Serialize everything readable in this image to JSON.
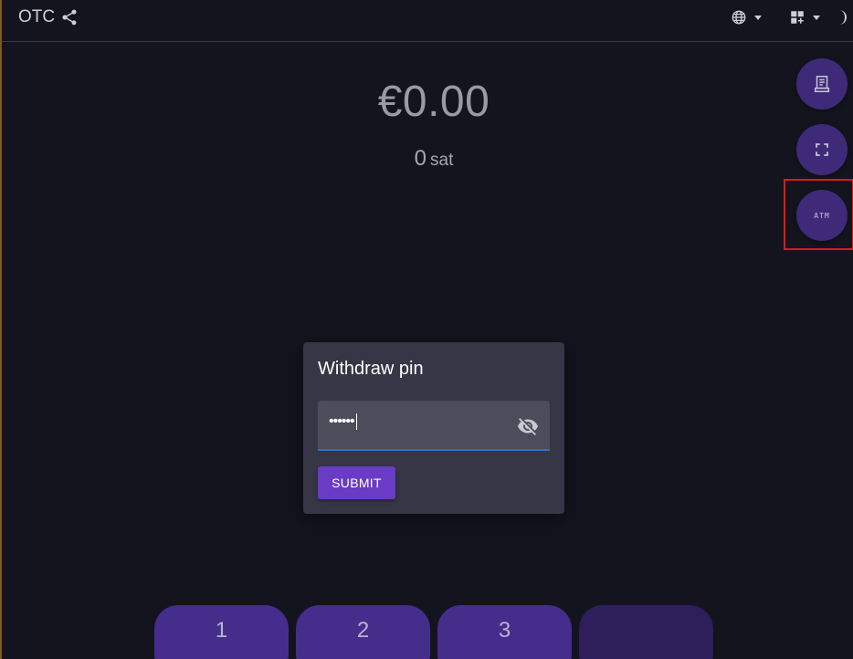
{
  "header": {
    "brand": "OTC",
    "share_icon": "share-icon",
    "language_icon": "globe-icon",
    "apps_icon": "apps-add-icon",
    "theme_icon": "crescent-moon-icon"
  },
  "display": {
    "amount": "€0.00",
    "sats_value": "0",
    "sats_unit": "sat"
  },
  "fabs": {
    "receipt_icon": "receipt-icon",
    "fullscreen_icon": "fullscreen-icon",
    "atm_label": "ATM"
  },
  "dialog": {
    "title": "Withdraw pin",
    "pin_masked": "••••••",
    "visibility_icon": "eye-off-icon",
    "submit_label": "SUBMIT"
  },
  "keypad": {
    "keys": [
      "1",
      "2",
      "3",
      ""
    ]
  },
  "colors": {
    "background": "#14141f",
    "accent": "#6a3bc4",
    "fab": "#3e2a78",
    "key": "#452d8c",
    "highlight": "#e01818"
  }
}
